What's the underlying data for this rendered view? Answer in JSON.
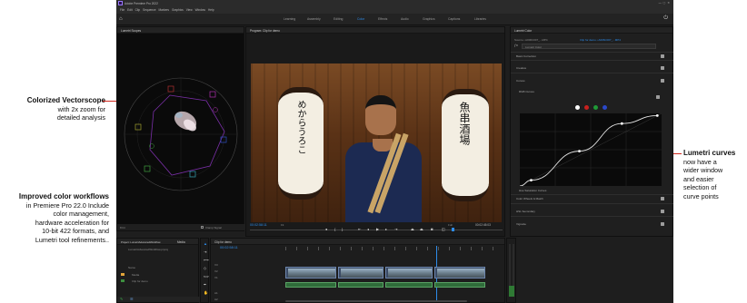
{
  "annotations": {
    "vectorscope": {
      "title": "Colorized Vectorscope",
      "body": [
        "with 2x zoom for",
        "detailed analysis"
      ]
    },
    "color_workflows": {
      "title": "Improved color workflows",
      "body": [
        "in Premiere Pro 22.0 Include",
        "color management,",
        "hardware acceleration for",
        "10-bit 422 formats, and",
        "Lumetri tool refinements.."
      ]
    },
    "lumetri_curves": {
      "title": "Lumetri curves",
      "body": [
        "now have a",
        "wider window",
        "and easier",
        "selection of",
        "curve points"
      ]
    }
  },
  "app": {
    "title": "Adobe Premiere Pro 2022",
    "menu": [
      "File",
      "Edit",
      "Clip",
      "Sequence",
      "Markers",
      "Graphics",
      "View",
      "Window",
      "Help"
    ],
    "workspaces": [
      "Learning",
      "Assembly",
      "Editing",
      "Color",
      "Effects",
      "Audio",
      "Graphics",
      "Captions",
      "Libraries"
    ],
    "active_workspace": "Color"
  },
  "scopes": {
    "title": "Lumetri Scopes",
    "footer": "Clamp Signal",
    "zoom": "8 bit"
  },
  "program": {
    "title": "Program: Clip for demo",
    "timecode_in": "00:02:58:11",
    "timecode_out": "00:02:45:03",
    "zoom": "Fit",
    "quality": "Full"
  },
  "sign_left": "めからうろこ",
  "sign_right": "魚串酒場",
  "project": {
    "title": "Project: LumetriAdvancedWorkflow",
    "tab2": "Media",
    "file": "LumetriAdvancedWorkflow.prproj",
    "col": "Name",
    "items": [
      "Media",
      "Clip for demo"
    ]
  },
  "timeline": {
    "title": "Clip for demo",
    "timecode": "00:02:58:11",
    "tracks": [
      "V3",
      "V2",
      "V1",
      "A1",
      "A2",
      "A3"
    ]
  },
  "lumetri": {
    "title": "Lumetri Color",
    "source": "Source • A006C007_...MP4",
    "sequence": "Clip for demo • A006C007_...MP4",
    "preset": "Lumetri Color",
    "sections": [
      "Basic Correction",
      "Creative",
      "Curves",
      "RGB Curves",
      "Hue Saturation Curves",
      "Color Wheels & Match",
      "HSL Secondary",
      "Vignette"
    ],
    "curve_points": [
      [
        0.08,
        0.92
      ],
      [
        0.42,
        0.52
      ],
      [
        0.72,
        0.14
      ],
      [
        0.97,
        0.03
      ]
    ]
  },
  "colors": {
    "accent": "#2d8ceb",
    "annotation": "#d0281e"
  }
}
